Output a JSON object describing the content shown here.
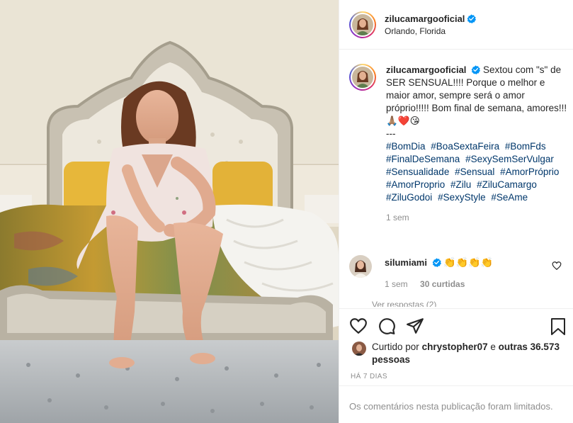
{
  "post": {
    "username": "zilucamargooficial",
    "location": "Orlando, Florida",
    "caption_text": "Sextou com \"s\" de SER SENSUAL!!!! Porque o melhor e maior amor, sempre será o amor próprio!!!!! Bom final de semana, amores!!! 🙏🏽❤️😘\n---",
    "hashtags": [
      "#BomDia",
      "#BoaSextaFeira",
      "#BomFds",
      "#FinalDeSemana",
      "#SexySemSerVulgar",
      "#Sensualidade",
      "#Sensual",
      "#AmorPróprio",
      "#AmorProprio",
      "#Zilu",
      "#ZiluCamargo",
      "#ZiluGodoi",
      "#SexyStyle",
      "#SeAme"
    ],
    "caption_time": "1 sem"
  },
  "comment": {
    "username": "silumiami",
    "text": "👏👏👏👏",
    "time": "1 sem",
    "likes": "30 curtidas",
    "view_replies": "Ver respostas (2)"
  },
  "likes_line": {
    "prefix": "Curtido por",
    "user": "chrystopher07",
    "middle": "e",
    "others": "outras 36.573 pessoas"
  },
  "date": "HÁ 7 DIAS",
  "comments_limited": "Os comentários nesta publicação foram limitados.",
  "icons": {
    "like": "heart-outline-icon",
    "comment": "comment-bubble-icon",
    "share": "paper-plane-icon",
    "save": "bookmark-icon",
    "verified": "verified-badge-icon"
  },
  "colors": {
    "verified": "#0095f6",
    "hashtag": "#00376b",
    "muted": "#8e8e8e",
    "text": "#262626"
  }
}
